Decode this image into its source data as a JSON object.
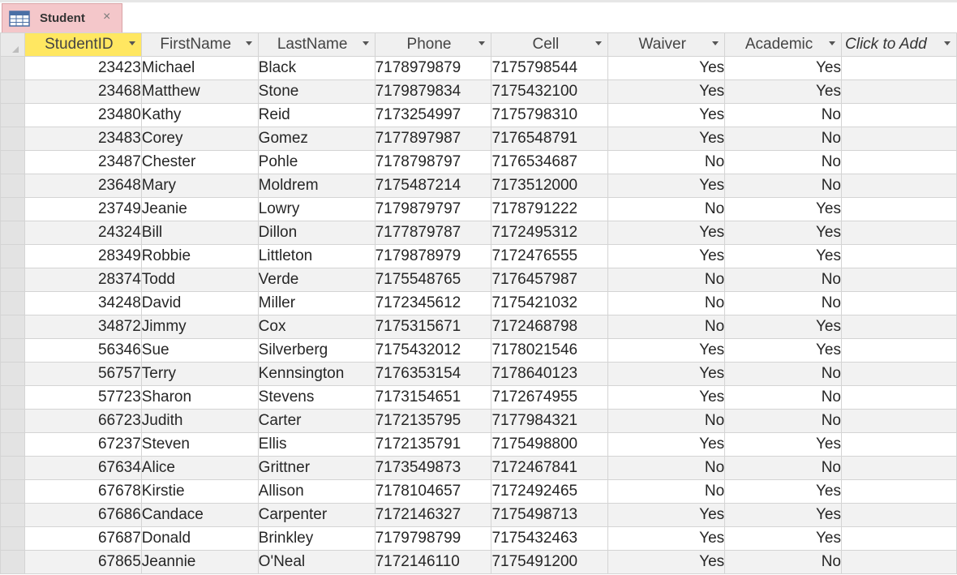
{
  "tab": {
    "title": "Student",
    "close": "×",
    "icon": "table-icon"
  },
  "columns": [
    "StudentID",
    "FirstName",
    "LastName",
    "Phone",
    "Cell",
    "Waiver",
    "Academic",
    "Click to Add"
  ],
  "rows": [
    [
      "23423",
      "Michael",
      "Black",
      "7178979879",
      "7175798544",
      "Yes",
      "Yes"
    ],
    [
      "23468",
      "Matthew",
      "Stone",
      "7179879834",
      "7175432100",
      "Yes",
      "Yes"
    ],
    [
      "23480",
      "Kathy",
      "Reid",
      "7173254997",
      "7175798310",
      "Yes",
      "No"
    ],
    [
      "23483",
      "Corey",
      "Gomez",
      "7177897987",
      "7176548791",
      "Yes",
      "No"
    ],
    [
      "23487",
      "Chester",
      "Pohle",
      "7178798797",
      "7176534687",
      "No",
      "No"
    ],
    [
      "23648",
      "Mary",
      "Moldrem",
      "7175487214",
      "7173512000",
      "Yes",
      "No"
    ],
    [
      "23749",
      "Jeanie",
      "Lowry",
      "7179879797",
      "7178791222",
      "No",
      "Yes"
    ],
    [
      "24324",
      "Bill",
      "Dillon",
      "7177879787",
      "7172495312",
      "Yes",
      "Yes"
    ],
    [
      "28349",
      "Robbie",
      "Littleton",
      "7179878979",
      "7172476555",
      "Yes",
      "Yes"
    ],
    [
      "28374",
      "Todd",
      "Verde",
      "7175548765",
      "7176457987",
      "No",
      "No"
    ],
    [
      "34248",
      "David",
      "Miller",
      "7172345612",
      "7175421032",
      "No",
      "No"
    ],
    [
      "34872",
      "Jimmy",
      "Cox",
      "7175315671",
      "7172468798",
      "No",
      "Yes"
    ],
    [
      "56346",
      "Sue",
      "Silverberg",
      "7175432012",
      "7178021546",
      "Yes",
      "Yes"
    ],
    [
      "56757",
      "Terry",
      "Kennsington",
      "7176353154",
      "7178640123",
      "Yes",
      "No"
    ],
    [
      "57723",
      "Sharon",
      "Stevens",
      "7173154651",
      "7172674955",
      "Yes",
      "No"
    ],
    [
      "66723",
      "Judith",
      "Carter",
      "7172135795",
      "7177984321",
      "No",
      "No"
    ],
    [
      "67237",
      "Steven",
      "Ellis",
      "7172135791",
      "7175498800",
      "Yes",
      "Yes"
    ],
    [
      "67634",
      "Alice",
      "Grittner",
      "7173549873",
      "7172467841",
      "No",
      "No"
    ],
    [
      "67678",
      "Kirstie",
      "Allison",
      "7178104657",
      "7172492465",
      "No",
      "Yes"
    ],
    [
      "67686",
      "Candace",
      "Carpenter",
      "7172146327",
      "7175498713",
      "Yes",
      "Yes"
    ],
    [
      "67687",
      "Donald",
      "Brinkley",
      "7179798799",
      "7175432463",
      "Yes",
      "Yes"
    ],
    [
      "67865",
      "Jeannie",
      "O'Neal",
      "7172146110",
      "7175491200",
      "Yes",
      "No"
    ]
  ],
  "colors": {
    "tab": "#f4c7ca",
    "key_header": "#ffe761",
    "alt_row": "#f2f2f2"
  }
}
